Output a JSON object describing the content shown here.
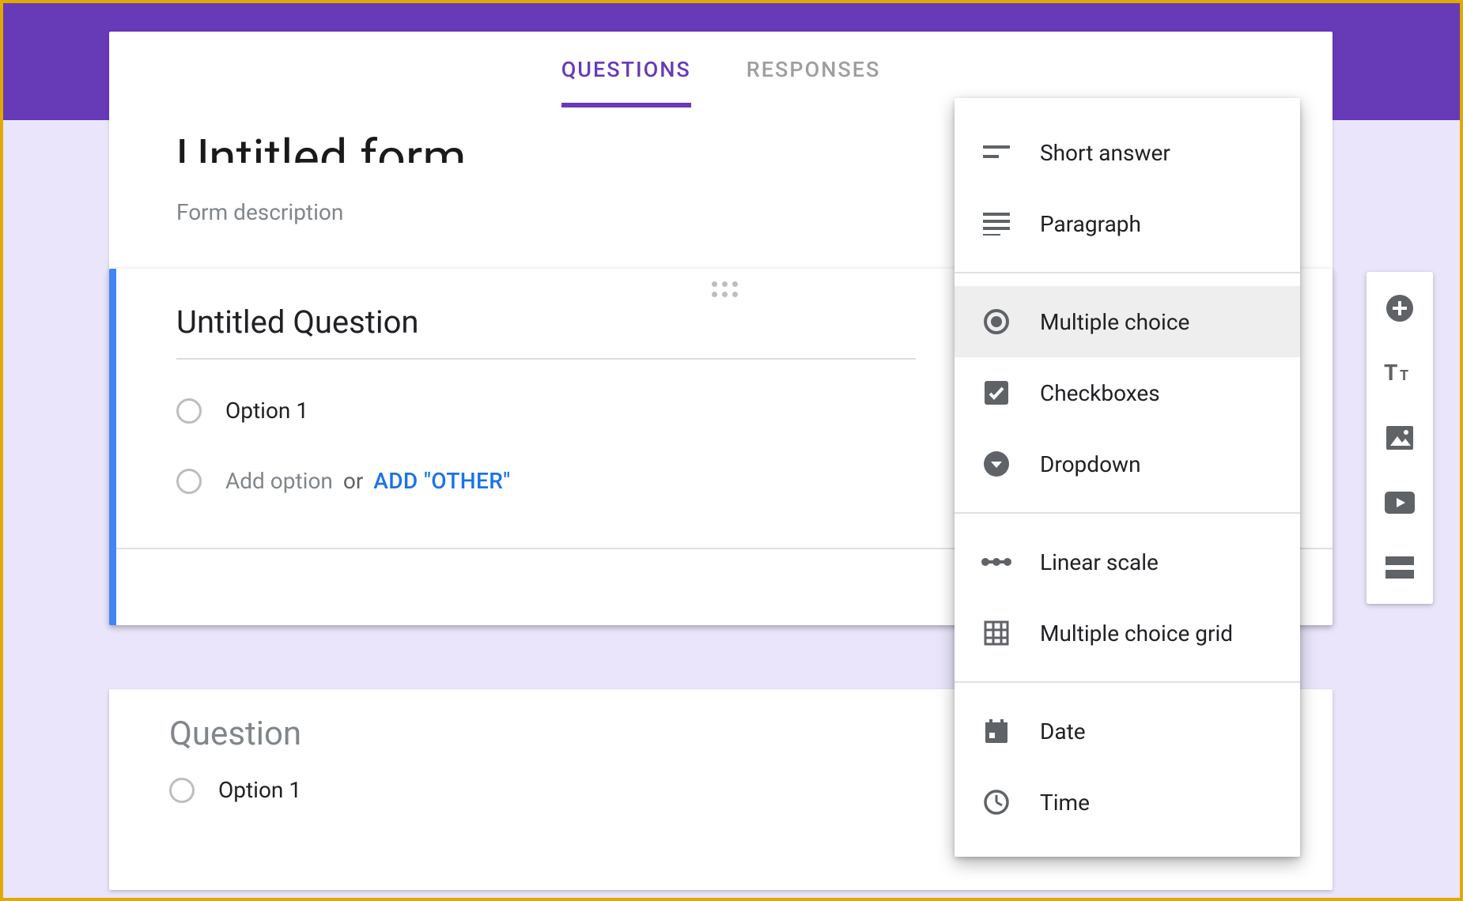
{
  "tabs": {
    "questions_label": "QUESTIONS",
    "responses_label": "RESPONSES"
  },
  "form": {
    "title": "Untitled form",
    "description_placeholder": "Form description"
  },
  "active_question": {
    "title": "Untitled Question",
    "option1_label": "Option 1",
    "add_option_label": "Add option",
    "or_label": "or",
    "add_other_label": "ADD \"OTHER\""
  },
  "inactive_question": {
    "title": "Question",
    "option1_label": "Option 1"
  },
  "type_menu": {
    "short_answer": "Short answer",
    "paragraph": "Paragraph",
    "multiple_choice": "Multiple choice",
    "checkboxes": "Checkboxes",
    "dropdown": "Dropdown",
    "linear_scale": "Linear scale",
    "mc_grid": "Multiple choice grid",
    "date": "Date",
    "time": "Time"
  },
  "icons": {
    "duplicate": "duplicate-icon",
    "add_question": "add-question-icon",
    "add_title": "add-title-icon",
    "add_image": "add-image-icon",
    "add_video": "add-video-icon",
    "add_section": "add-section-icon"
  },
  "colors": {
    "accent": "#673ab7",
    "link": "#1a73e8",
    "outer_border": "#e0aa00"
  }
}
